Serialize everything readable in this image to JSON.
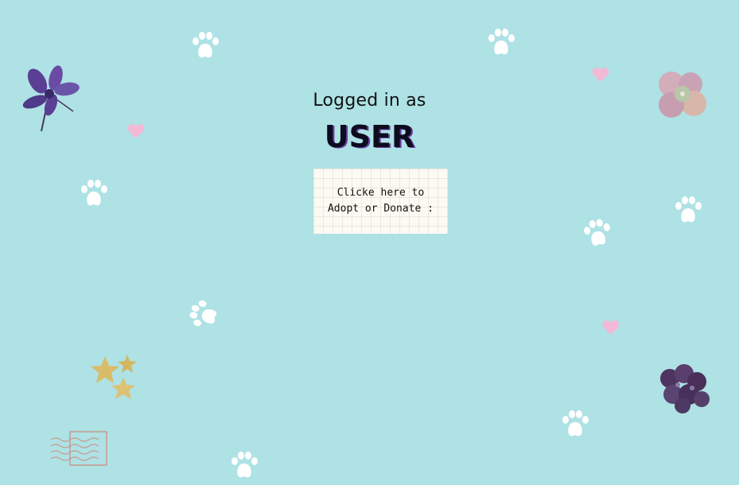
{
  "header": {
    "logged_in_label": "Logged in as",
    "username": "USER"
  },
  "action_card": {
    "line1": "Clicke here to",
    "line2": "Adopt or Donate :"
  },
  "colors": {
    "background": "#aee2e5",
    "paw": "#ffffff",
    "heart": "#f3b8d6",
    "star": "#d8bc6a",
    "flower_purple": "#5a3f95",
    "flower_pink": "#cfa9b7",
    "flower_dark": "#4e3560",
    "stamp_line": "#c89a8f"
  },
  "decorations": {
    "paw_icon": "paw-print-icon",
    "heart_icon": "heart-icon",
    "star_icon": "star-icon",
    "flower_icon": "pressed-flower-icon",
    "stamp_icon": "postmark-stamp-icon"
  }
}
